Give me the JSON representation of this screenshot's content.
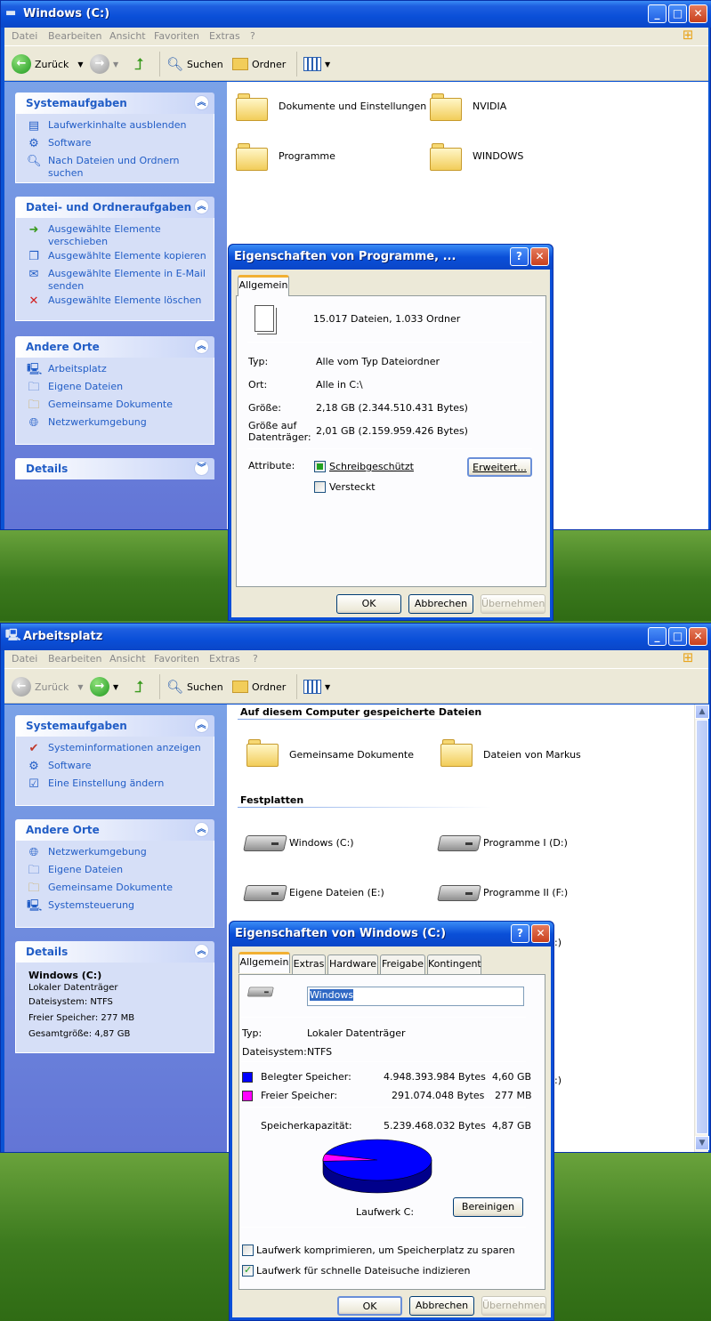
{
  "window1": {
    "title": "Windows (C:)",
    "menu": [
      "Datei",
      "Bearbeiten",
      "Ansicht",
      "Favoriten",
      "Extras",
      "?"
    ],
    "toolbar": {
      "back": "Zurück",
      "search": "Suchen",
      "folders": "Ordner"
    },
    "panels": {
      "system": {
        "title": "Systemaufgaben",
        "items": [
          "Laufwerkinhalte ausblenden",
          "Software",
          "Nach Dateien und Ordnern suchen"
        ]
      },
      "file": {
        "title": "Datei- und Ordneraufgaben",
        "items": [
          "Ausgewählte Elemente verschieben",
          "Ausgewählte Elemente kopieren",
          "Ausgewählte Elemente in E-Mail senden",
          "Ausgewählte Elemente löschen"
        ]
      },
      "other": {
        "title": "Andere Orte",
        "items": [
          "Arbeitsplatz",
          "Eigene Dateien",
          "Gemeinsame Dokumente",
          "Netzwerkumgebung"
        ]
      },
      "details": {
        "title": "Details"
      }
    },
    "folders": [
      "Dokumente und Einstellungen",
      "NVIDIA",
      "Programme",
      "WINDOWS"
    ]
  },
  "dialog1": {
    "title": "Eigenschaften von Programme, ...",
    "tab": "Allgemein",
    "summary": "15.017 Dateien, 1.033 Ordner",
    "rows": {
      "type_label": "Typ:",
      "type_value": "Alle vom Typ Dateiordner",
      "loc_label": "Ort:",
      "loc_value": "Alle in C:\\",
      "size_label": "Größe:",
      "size_value": "2,18 GB (2.344.510.431 Bytes)",
      "disk_label_1": "Größe auf",
      "disk_label_2": "Datenträger:",
      "disk_value": "2,01 GB (2.159.959.426 Bytes)",
      "attr_label": "Attribute:"
    },
    "readonly": "Schreibgeschützt",
    "hidden": "Versteckt",
    "advanced": "Erweitert...",
    "ok": "OK",
    "cancel": "Abbrechen",
    "apply": "Übernehmen"
  },
  "window2": {
    "title": "Arbeitsplatz",
    "menu": [
      "Datei",
      "Bearbeiten",
      "Ansicht",
      "Favoriten",
      "Extras",
      "?"
    ],
    "toolbar": {
      "back": "Zurück",
      "search": "Suchen",
      "folders": "Ordner"
    },
    "panels": {
      "system": {
        "title": "Systemaufgaben",
        "items": [
          "Systeminformationen anzeigen",
          "Software",
          "Eine Einstellung ändern"
        ]
      },
      "other": {
        "title": "Andere Orte",
        "items": [
          "Netzwerkumgebung",
          "Eigene Dateien",
          "Gemeinsame Dokumente",
          "Systemsteuerung"
        ]
      },
      "details": {
        "title": "Details",
        "name": "Windows (C:)",
        "lines": [
          "Lokaler Datenträger",
          "Dateisystem: NTFS",
          "Freier Speicher: 277 MB",
          "Gesamtgröße: 4,87 GB"
        ]
      }
    },
    "section_files": "Auf diesem Computer gespeicherte Dateien",
    "files": [
      "Gemeinsame Dokumente",
      "Dateien von Markus"
    ],
    "section_drives": "Festplatten",
    "drives": [
      "Windows (C:)",
      "Programme I (D:)",
      "Eigene Dateien (E:)",
      "Programme II (F:)"
    ],
    "partial": [
      ":)",
      ":)"
    ]
  },
  "dialog2": {
    "title": "Eigenschaften von Windows (C:)",
    "tabs": [
      "Allgemein",
      "Extras",
      "Hardware",
      "Freigabe",
      "Kontingent"
    ],
    "name_value": "Windows",
    "type_label": "Typ:",
    "type_value": "Lokaler Datenträger",
    "fs_label": "Dateisystem:",
    "fs_value": "NTFS",
    "used_label": "Belegter Speicher:",
    "used_bytes": "4.948.393.984 Bytes",
    "used_short": "4,60 GB",
    "free_label": "Freier Speicher:",
    "free_bytes": "291.074.048 Bytes",
    "free_short": "277 MB",
    "cap_label": "Speicherkapazität:",
    "cap_bytes": "5.239.468.032 Bytes",
    "cap_short": "4,87 GB",
    "drive_label": "Laufwerk C:",
    "cleanup": "Bereinigen",
    "compress": "Laufwerk komprimieren, um Speicherplatz zu sparen",
    "index": "Laufwerk für schnelle Dateisuche indizieren",
    "ok": "OK",
    "cancel": "Abbrechen",
    "apply": "Übernehmen",
    "colors": {
      "used": "#0000ff",
      "free": "#ff00ff"
    },
    "used_fraction": 0.944
  }
}
